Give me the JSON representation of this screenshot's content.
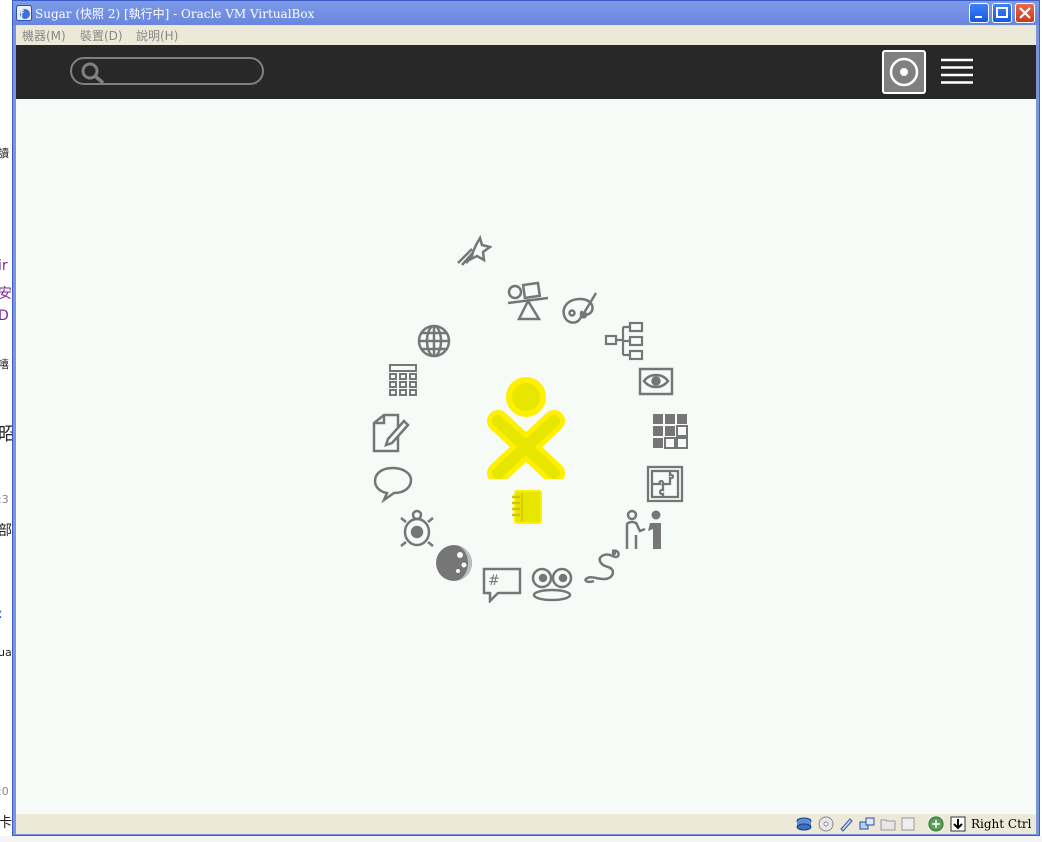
{
  "window": {
    "title": "Sugar (快照 2) [執行中] - Oracle VM VirtualBox"
  },
  "menu": {
    "items": [
      {
        "label": "機器(M)"
      },
      {
        "label": "裝置(D)"
      },
      {
        "label": "說明(H)"
      }
    ]
  },
  "sugar": {
    "search": {
      "placeholder": "",
      "value": ""
    },
    "activities": [
      "browse-icon",
      "physics-icon",
      "paint-icon",
      "mindmap-icon",
      "view-source-icon",
      "implode-icon",
      "jigsaw-icon",
      "speak-icon",
      "pippy-icon",
      "record-icon",
      "irc-icon",
      "moon-icon",
      "turtle-art-icon",
      "chat-icon",
      "write-icon",
      "calculate-icon",
      "globe-icon",
      "labyrinth-icon"
    ],
    "colors": {
      "toolbar": "#282828",
      "background": "#f7fbf8",
      "xo_fill": "#e6e600",
      "xo_stroke": "#fff000",
      "icon_gray": "#767676"
    }
  },
  "statusbar": {
    "host_key": "Right Ctrl"
  }
}
